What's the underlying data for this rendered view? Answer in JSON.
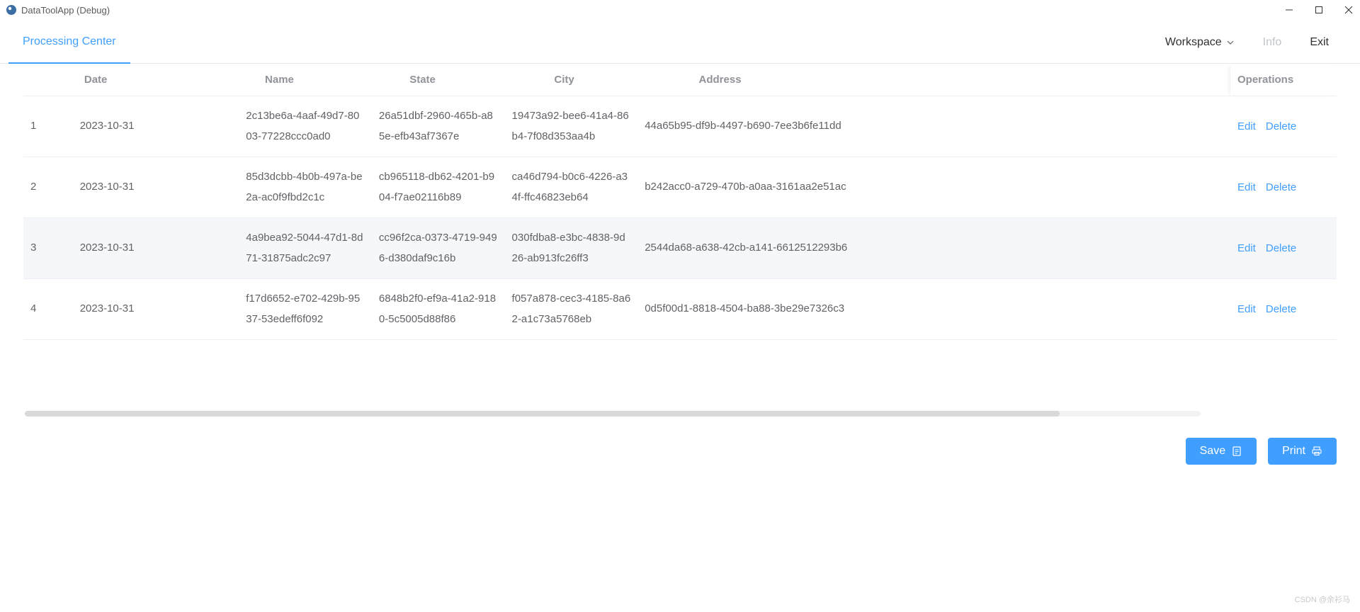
{
  "window": {
    "title": "DataToolApp (Debug)"
  },
  "menu": {
    "active": "Processing Center",
    "workspace": "Workspace",
    "info": "Info",
    "exit": "Exit"
  },
  "table": {
    "headers": {
      "date": "Date",
      "name": "Name",
      "state": "State",
      "city": "City",
      "address": "Address",
      "operations": "Operations"
    },
    "ops": {
      "edit": "Edit",
      "delete": "Delete"
    },
    "hover_index": 2,
    "rows": [
      {
        "idx": "1",
        "date": "2023-10-31",
        "name": "2c13be6a-4aaf-49d7-8003-77228ccc0ad0",
        "state": "26a51dbf-2960-465b-a85e-efb43af7367e",
        "city": "19473a92-bee6-41a4-86b4-7f08d353aa4b",
        "address": "44a65b95-df9b-4497-b690-7ee3b6fe11dd"
      },
      {
        "idx": "2",
        "date": "2023-10-31",
        "name": "85d3dcbb-4b0b-497a-be2a-ac0f9fbd2c1c",
        "state": "cb965118-db62-4201-b904-f7ae02116b89",
        "city": "ca46d794-b0c6-4226-a34f-ffc46823eb64",
        "address": "b242acc0-a729-470b-a0aa-3161aa2e51ac"
      },
      {
        "idx": "3",
        "date": "2023-10-31",
        "name": "4a9bea92-5044-47d1-8d71-31875adc2c97",
        "state": "cc96f2ca-0373-4719-9496-d380daf9c16b",
        "city": "030fdba8-e3bc-4838-9d26-ab913fc26ff3",
        "address": "2544da68-a638-42cb-a141-6612512293b6"
      },
      {
        "idx": "4",
        "date": "2023-10-31",
        "name": "f17d6652-e702-429b-9537-53edeff6f092",
        "state": "6848b2f0-ef9a-41a2-9180-5c5005d88f86",
        "city": "f057a878-cec3-4185-8a62-a1c73a5768eb",
        "address": "0d5f00d1-8818-4504-ba88-3be29e7326c3"
      }
    ]
  },
  "footer": {
    "save": "Save",
    "print": "Print"
  },
  "watermark": "CSDN @余衫马"
}
